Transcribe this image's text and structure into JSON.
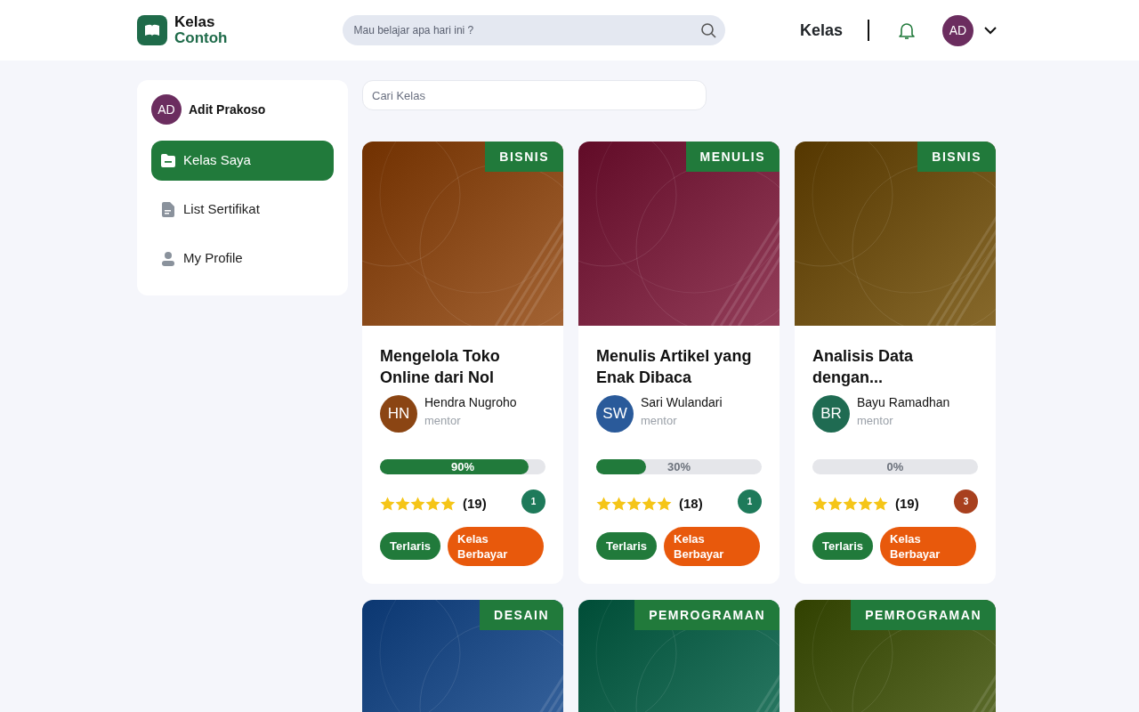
{
  "header": {
    "logo": {
      "line_1": "Kelas",
      "line_2": "Contoh"
    },
    "search": {
      "placeholder": "Mau belajar apa hari ini ?"
    },
    "nav_link": "Kelas",
    "user_avatar": "AD"
  },
  "sidebar": {
    "user": {
      "initials": "AD",
      "name": "Adit Prakoso"
    },
    "items": [
      {
        "label": "Kelas Saya",
        "selected": true
      },
      {
        "label": "List Sertifikat",
        "selected": false
      },
      {
        "label": "My Profile",
        "selected": false
      }
    ]
  },
  "class_search": {
    "placeholder": "Cari Kelas"
  },
  "courses": [
    {
      "category": "BISNIS",
      "color": "#8a4a1a",
      "title": "Mengelola Toko Online dari Nol",
      "mentor": {
        "initials": "HN",
        "name": "Hendra Nugroho",
        "role": "mentor",
        "color": "#8b4513"
      },
      "progress": {
        "level": 0.9,
        "label": "90%"
      },
      "stars": 5,
      "reviews": "(19)",
      "count": {
        "value": "1",
        "color": "#1e7a5a"
      },
      "tags": [
        "Terlaris",
        "Kelas Berbayar"
      ]
    },
    {
      "category": "MENULIS",
      "color": "#7a2440",
      "title": "Menulis Artikel yang Enak Dibaca",
      "mentor": {
        "initials": "SW",
        "name": "Sari Wulandari",
        "role": "mentor",
        "color": "#2a5a9a"
      },
      "progress": {
        "level": 0.3,
        "label": "30%"
      },
      "stars": 5,
      "reviews": "(18)",
      "count": {
        "value": "1",
        "color": "#1e7a5a"
      },
      "tags": [
        "Terlaris",
        "Kelas Berbayar"
      ]
    },
    {
      "category": "BISNIS",
      "color": "#6e5012",
      "title": "Analisis Data dengan...",
      "mentor": {
        "initials": "BR",
        "name": "Bayu Ramadhan",
        "role": "mentor",
        "color": "#1f6b52"
      },
      "progress": {
        "level": 0,
        "label": "0%"
      },
      "stars": 5,
      "reviews": "(19)",
      "count": {
        "value": "3",
        "color": "#a8401e"
      },
      "tags": [
        "Terlaris",
        "Kelas Berbayar"
      ]
    },
    {
      "category": "DESAIN",
      "color": "#24508a"
    },
    {
      "category": "PEMROGRAMAN",
      "color": "#166650"
    },
    {
      "category": "PEMROGRAMAN",
      "color": "#4a5a1a"
    }
  ]
}
